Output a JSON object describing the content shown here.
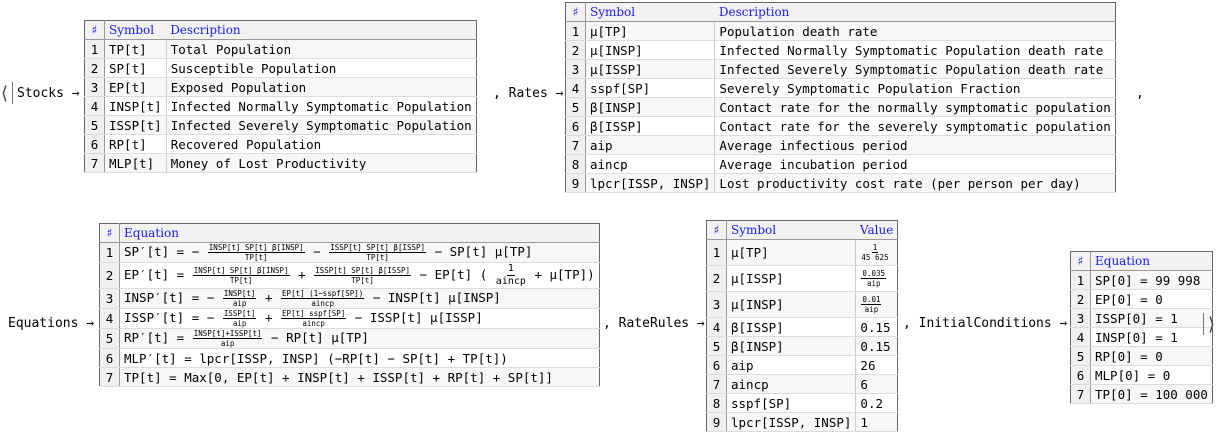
{
  "labels": {
    "stocks": "Stocks →",
    "rates": ", Rates →",
    "rates_comma": ",",
    "equations": "Equations →",
    "raterules": ", RateRules →",
    "initialconditions": ", InitialConditions →",
    "open_angle": "⟨",
    "close_angle": "⟩",
    "hash": "♯"
  },
  "stocks": {
    "headers": [
      "Symbol",
      "Description"
    ],
    "rows": [
      [
        "1",
        "TP[t]",
        "Total Population"
      ],
      [
        "2",
        "SP[t]",
        "Susceptible Population"
      ],
      [
        "3",
        "EP[t]",
        "Exposed Population"
      ],
      [
        "4",
        "INSP[t]",
        "Infected Normally Symptomatic Population"
      ],
      [
        "5",
        "ISSP[t]",
        "Infected Severely Symptomatic Population"
      ],
      [
        "6",
        "RP[t]",
        "Recovered Population"
      ],
      [
        "7",
        "MLP[t]",
        "Money of Lost Productivity"
      ]
    ]
  },
  "rates": {
    "headers": [
      "Symbol",
      "Description"
    ],
    "rows": [
      [
        "1",
        "μ[TP]",
        "Population death rate"
      ],
      [
        "2",
        "μ[INSP]",
        "Infected Normally Symptomatic Population death rate"
      ],
      [
        "3",
        "μ[ISSP]",
        "Infected Severely Symptomatic Population death rate"
      ],
      [
        "4",
        "sspf[SP]",
        "Severely Symptomatic Population Fraction"
      ],
      [
        "5",
        "β[INSP]",
        "Contact rate for the normally symptomatic population"
      ],
      [
        "6",
        "β[ISSP]",
        "Contact rate for the severely symptomatic population"
      ],
      [
        "7",
        "aip",
        "Average infectious period"
      ],
      [
        "8",
        "aincp",
        "Average incubation period"
      ],
      [
        "9",
        "lpcr[ISSP, INSP]",
        "Lost productivity cost rate (per person per day)"
      ]
    ]
  },
  "equations": {
    "header": "Equation",
    "rows": [
      {
        "n": "1",
        "lhs": "SP′[t] = −",
        "f1n": "INSP[t] SP[t] β[INSP]",
        "f1d": "TP[t]",
        "mid": "−",
        "f2n": "ISSP[t] SP[t] β[ISSP]",
        "f2d": "TP[t]",
        "tail": "− SP[t] μ[TP]"
      },
      {
        "n": "2",
        "lhs": "EP′[t] =",
        "f1n": "INSP[t] SP[t] β[INSP]",
        "f1d": "TP[t]",
        "mid": "+",
        "f2n": "ISSP[t] SP[t] β[ISSP]",
        "f2d": "TP[t]",
        "tail": "− EP[t] (",
        "f3n": "1",
        "f3d": "aincp",
        "tail2": "+ μ[TP])"
      },
      {
        "n": "3",
        "lhs": "INSP′[t] = −",
        "f1n": "INSP[t]",
        "f1d": "aip",
        "mid": "+",
        "f2n": "EP[t] (1−sspf[SP])",
        "f2d": "aincp",
        "tail": "− INSP[t] μ[INSP]"
      },
      {
        "n": "4",
        "lhs": "ISSP′[t] = −",
        "f1n": "ISSP[t]",
        "f1d": "aip",
        "mid": "+",
        "f2n": "EP[t] sspf[SP]",
        "f2d": "aincp",
        "tail": "− ISSP[t] μ[ISSP]"
      },
      {
        "n": "5",
        "lhs": "RP′[t] =",
        "f1n": "INSP[t]+ISSP[t]",
        "f1d": "aip",
        "mid": "",
        "f2n": "",
        "f2d": "",
        "tail": "− RP[t] μ[TP]"
      },
      {
        "n": "6",
        "plain": "MLP′[t] = lpcr[ISSP, INSP] (−RP[t] − SP[t] + TP[t])"
      },
      {
        "n": "7",
        "plain": "TP[t] = Max[0, EP[t] + INSP[t] + ISSP[t] + RP[t] + SP[t]]"
      }
    ]
  },
  "raterules": {
    "headers": [
      "Symbol",
      "Value"
    ],
    "rows": [
      {
        "n": "1",
        "sym": "μ[TP]",
        "num": "1",
        "den": "45 625"
      },
      {
        "n": "2",
        "sym": "μ[ISSP]",
        "num": "0.035",
        "den": "aip"
      },
      {
        "n": "3",
        "sym": "μ[INSP]",
        "num": "0.01",
        "den": "aip"
      },
      {
        "n": "4",
        "sym": "β[ISSP]",
        "val": "0.15"
      },
      {
        "n": "5",
        "sym": "β[INSP]",
        "val": "0.15"
      },
      {
        "n": "6",
        "sym": "aip",
        "val": "26"
      },
      {
        "n": "7",
        "sym": "aincp",
        "val": "6"
      },
      {
        "n": "8",
        "sym": "sspf[SP]",
        "val": "0.2"
      },
      {
        "n": "9",
        "sym": "lpcr[ISSP, INSP]",
        "val": "1"
      }
    ]
  },
  "initial": {
    "header": "Equation",
    "rows": [
      [
        "1",
        "SP[0] = 99 998"
      ],
      [
        "2",
        "EP[0] = 0"
      ],
      [
        "3",
        "ISSP[0] = 1"
      ],
      [
        "4",
        "INSP[0] = 1"
      ],
      [
        "5",
        "RP[0] = 0"
      ],
      [
        "6",
        "MLP[0] = 0"
      ],
      [
        "7",
        "TP[0] = 100 000"
      ]
    ]
  }
}
